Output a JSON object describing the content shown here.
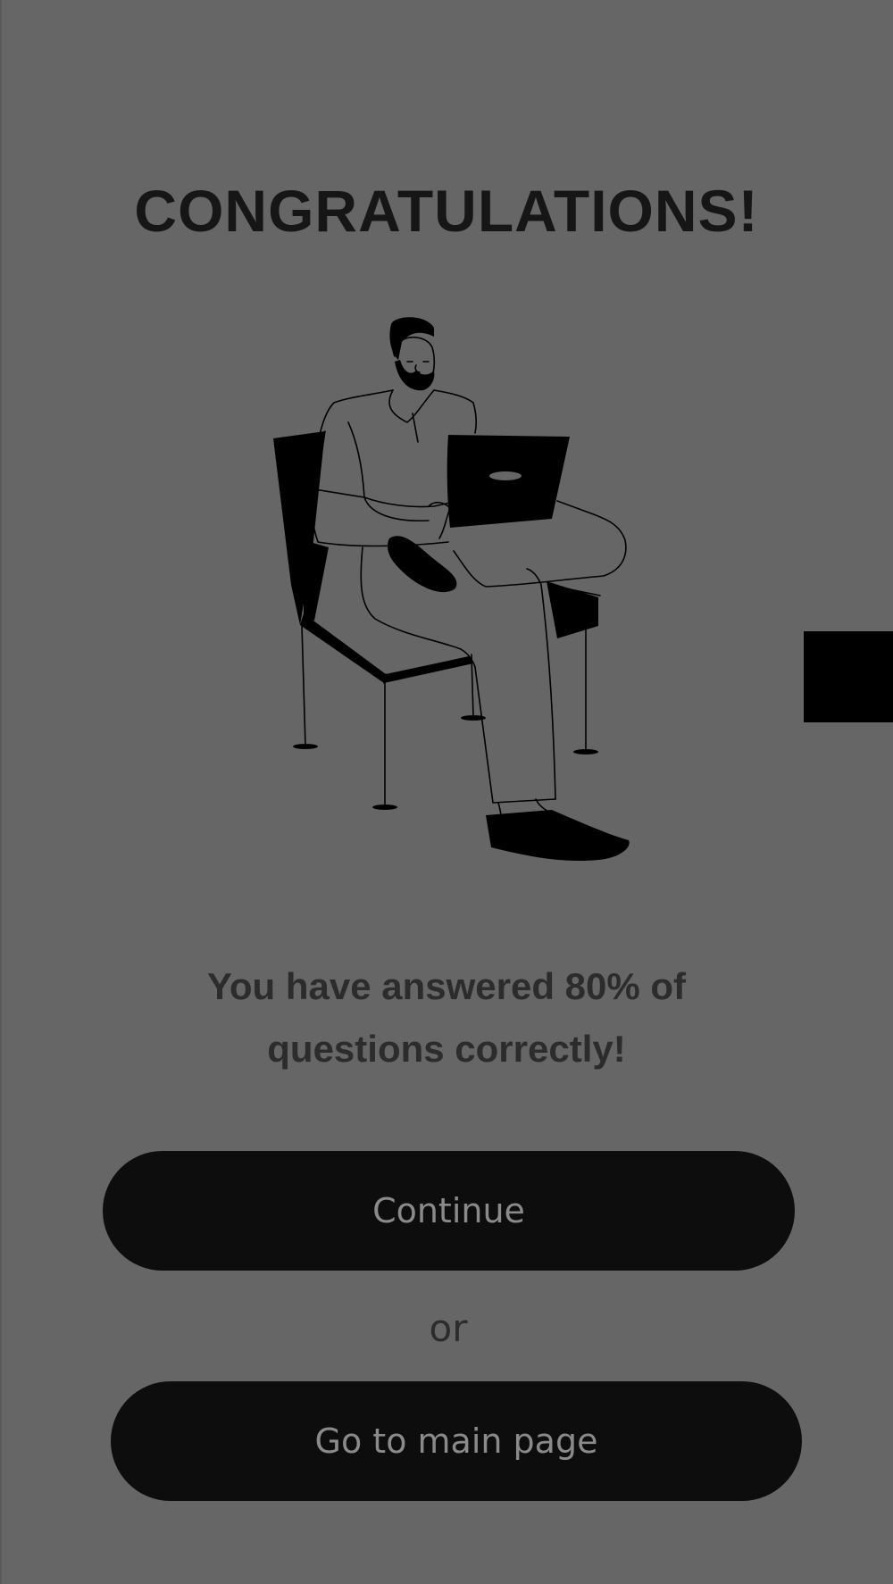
{
  "screen": {
    "title": "CONGRATULATIONS!",
    "result_message": "You have answered 80% of questions correctly!",
    "score_percent": 80,
    "illustration": "man-with-laptop-on-chair-illustration"
  },
  "actions": {
    "continue_label": "Continue",
    "separator_label": "or",
    "main_page_label": "Go to main page"
  },
  "colors": {
    "background": "#666666",
    "title": "#161616",
    "message": "#2c2c2c",
    "button_bg": "#0d0d0d",
    "button_text": "#8a8a8a"
  }
}
